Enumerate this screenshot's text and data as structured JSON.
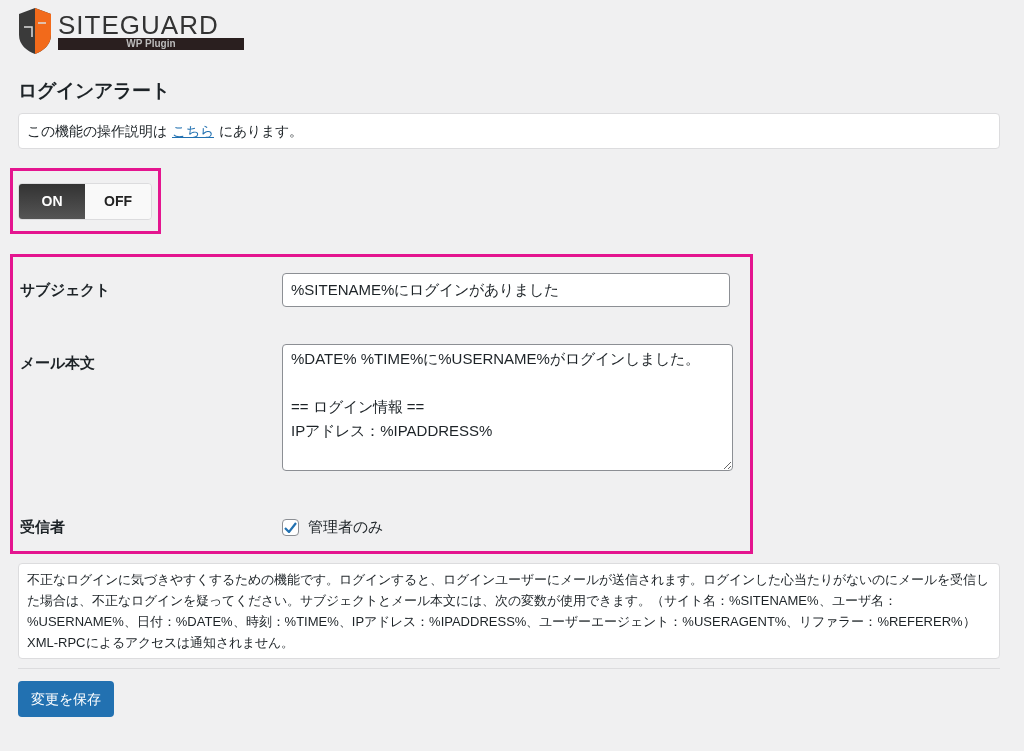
{
  "logo": {
    "name": "SITEGUARD",
    "tagline": "WP Plugin"
  },
  "page_title": "ログインアラート",
  "notice": {
    "before": "この機能の操作説明は",
    "link": "こちら",
    "after": "にあります。"
  },
  "toggle": [
    {
      "label": "ON",
      "selected": true
    },
    {
      "label": "OFF",
      "selected": false
    }
  ],
  "form": {
    "subject": {
      "label": "サブジェクト",
      "value": "%SITENAME%にログインがありました"
    },
    "body": {
      "label": "メール本文",
      "value": "%DATE% %TIME%に%USERNAME%がログインしました。\n\n== ログイン情報 ==\nIPアドレス：%IPADDRESS%"
    },
    "recipient": {
      "label": "受信者",
      "option": "管理者のみ",
      "checked": true
    }
  },
  "description": "不正なログインに気づきやすくするための機能です。ログインすると、ログインユーザーにメールが送信されます。ログインした心当たりがないのにメールを受信した場合は、不正なログインを疑ってください。サブジェクトとメール本文には、次の変数が使用できます。（サイト名：%SITENAME%、ユーザ名：%USERNAME%、日付：%DATE%、時刻：%TIME%、IPアドレス：%IPADDRESS%、ユーザーエージェント：%USERAGENT%、リファラー：%REFERER%）XML-RPCによるアクセスは通知されません。",
  "save_button": "変更を保存"
}
